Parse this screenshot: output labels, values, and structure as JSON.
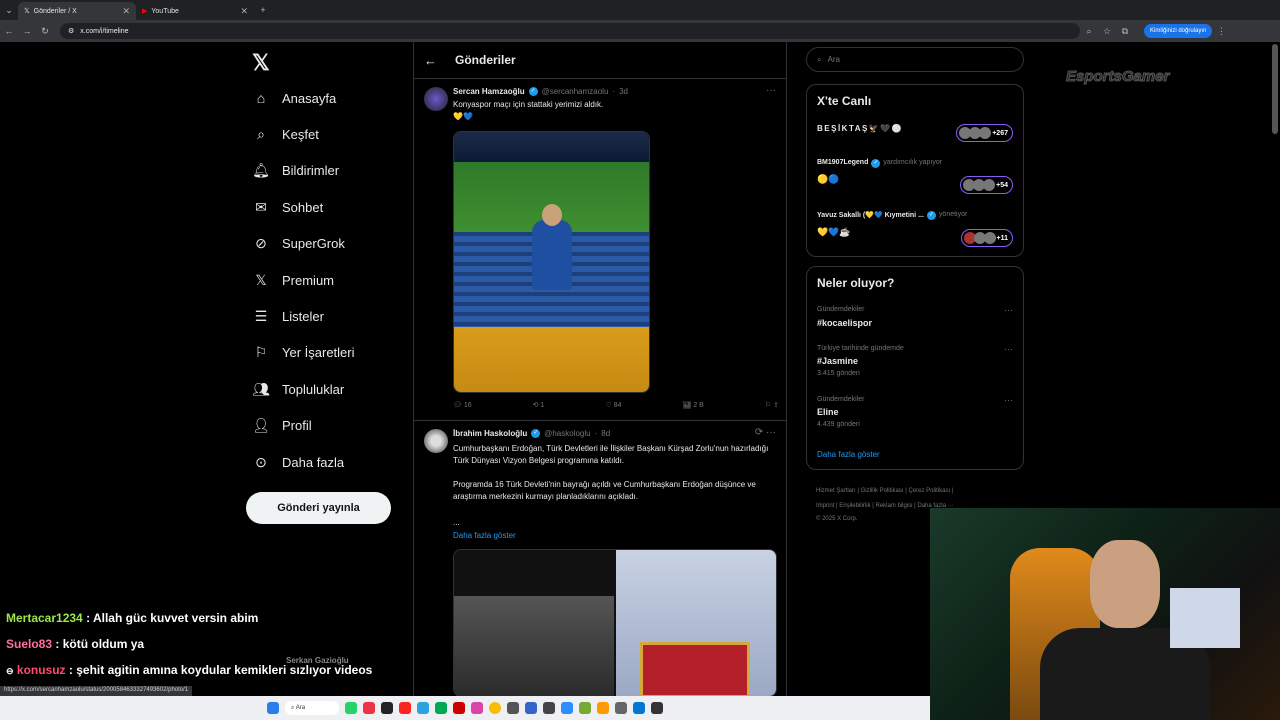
{
  "browser": {
    "tabs": [
      {
        "label": "Gönderiler / X"
      },
      {
        "label": "YouTube"
      }
    ],
    "url": "x.com/i/timeline",
    "verify_label": "Kimliğinizi doğrulayın",
    "status_url": "https://x.com/sercanhamzaolu/status/2000584633327493602/photo/1"
  },
  "nav": {
    "items": [
      {
        "label": "Anasayfa",
        "icon": "home-icon"
      },
      {
        "label": "Keşfet",
        "icon": "search-icon"
      },
      {
        "label": "Bildirimler",
        "icon": "bell-icon"
      },
      {
        "label": "Sohbet",
        "icon": "mail-icon"
      },
      {
        "label": "SuperGrok",
        "icon": "grok-icon"
      },
      {
        "label": "Premium",
        "icon": "x-icon"
      },
      {
        "label": "Listeler",
        "icon": "list-icon"
      },
      {
        "label": "Yer İşaretleri",
        "icon": "bookmark-icon"
      },
      {
        "label": "Topluluklar",
        "icon": "people-icon"
      },
      {
        "label": "Profil",
        "icon": "person-icon"
      },
      {
        "label": "Daha fazla",
        "icon": "more-circle-icon"
      }
    ],
    "post_button": "Gönderi yayınla"
  },
  "header": {
    "title": "Gönderiler"
  },
  "tweets": [
    {
      "name": "Sercan Hamzaoğlu",
      "handle": "@sercanhamzaolu",
      "time": "3d",
      "text": "Konyaspor maçı için stattaki yerimizi aldık.",
      "emoji": "💛💙",
      "replies": "16",
      "retweets": "1",
      "likes": "84",
      "views": "2 B"
    },
    {
      "name": "İbrahim Haskoloğlu",
      "handle": "@haskologlu",
      "time": "8d",
      "text1": "Cumhurbaşkanı Erdoğan, Türk Devletleri ile İlişkiler Başkanı Kürşad Zorlu'nun hazırladığı Türk Dünyası Vizyon Belgesi programına katıldı.",
      "text2": "Programda 16 Türk Devleti'nin bayrağı açıldı ve Cumhurbaşkanı Erdoğan düşünce ve araştırma merkezini kurmayı planladıklarını açıkladı.",
      "text3": "...",
      "show_more": "Daha fazla göster"
    }
  ],
  "search": {
    "placeholder": "Ara"
  },
  "live": {
    "title": "X'te Canlı",
    "entries": [
      {
        "name": "BEŞİKTAŞ🦅🖤⚪",
        "count": "+267"
      },
      {
        "name": "BM1907Legend",
        "meta": "yardımcılık yapıyor",
        "emoji": "🟡🔵",
        "count": "+54"
      },
      {
        "name": "Yavuz Sakallı (💛💙 Kıymetini ...",
        "meta": "yönetiyor",
        "emoji": "💛💙☕",
        "count": "+11"
      }
    ]
  },
  "trends": {
    "title": "Neler oluyor?",
    "items": [
      {
        "meta": "Gündemdekiler",
        "name": "#kocaelispor",
        "count": ""
      },
      {
        "meta": "Türkiye tarihinde gündemde",
        "name": "#Jasmine",
        "count": "3.415 gönderi"
      },
      {
        "meta": "Gündemdekiler",
        "name": "Eline",
        "count": "4.439 gönderi"
      }
    ],
    "show_more": "Daha fazla göster"
  },
  "footer": {
    "line1": "Hizmet Şartları  |  Gizlilik Politikası  |  Çerez Politikası  |",
    "line2": "Imprint  |  Erişilebilirlik  |  Reklam bilgisi  |  Daha fazla ···",
    "line3": "© 2025 X Corp."
  },
  "overlay": {
    "brand": "EsportsGamer",
    "chat": [
      {
        "user": "Mertacar1234",
        "color": "#9ce84a",
        "msg": ": Allah güc kuvvet versin abim"
      },
      {
        "user": "Suelo83",
        "color": "#ff6f9f",
        "msg": ": kötü oldum ya"
      },
      {
        "user": "konusuz",
        "color": "#ff4d6d",
        "msg": ": şehit agitin amına koydular kemikleri sızlıyor videos"
      }
    ],
    "faded_name": "Serkan Gazioğlu"
  }
}
